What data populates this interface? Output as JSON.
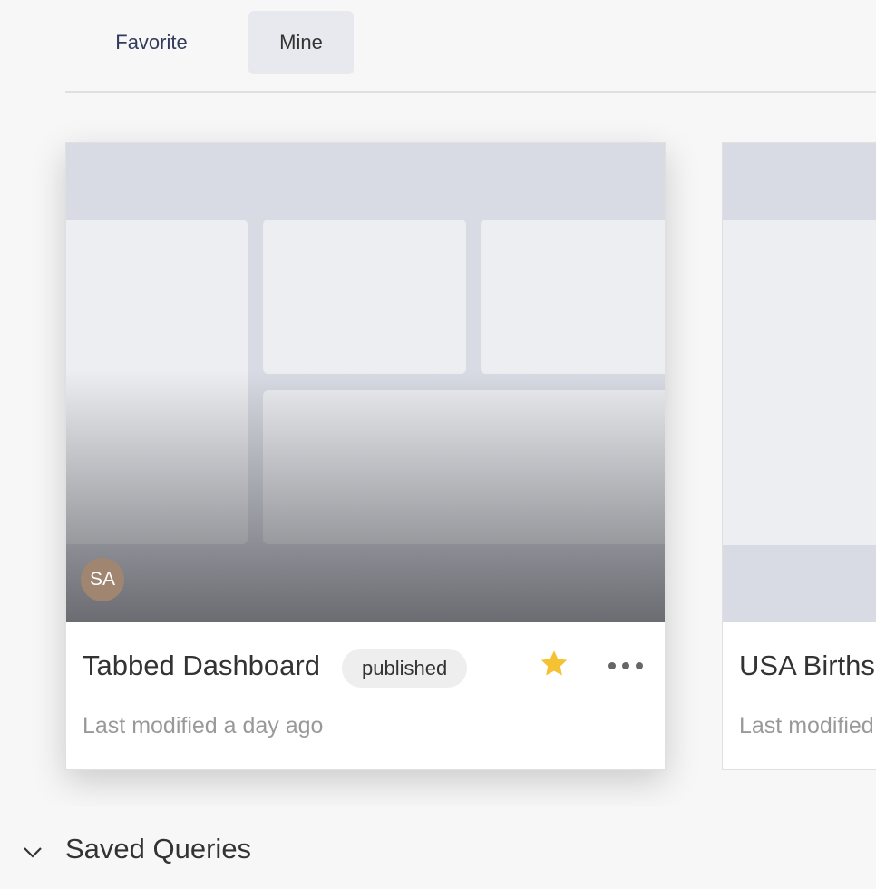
{
  "tabs": [
    {
      "label": "Favorite"
    },
    {
      "label": "Mine"
    }
  ],
  "cards": [
    {
      "title": "Tabbed Dashboard",
      "status": "published",
      "modified": "Last modified a day ago",
      "owner_initials": "SA",
      "favorite_icon": "star-icon",
      "menu_icon": "more-horizontal-icon"
    },
    {
      "title": "USA Births Names",
      "modified": "Last modified a day ago"
    }
  ],
  "section": {
    "label": "Saved Queries",
    "icon": "chevron-down-icon"
  },
  "colors": {
    "star": "#f5c233",
    "avatar": "#a08570",
    "tab_active_bg": "#e8e9ee"
  }
}
